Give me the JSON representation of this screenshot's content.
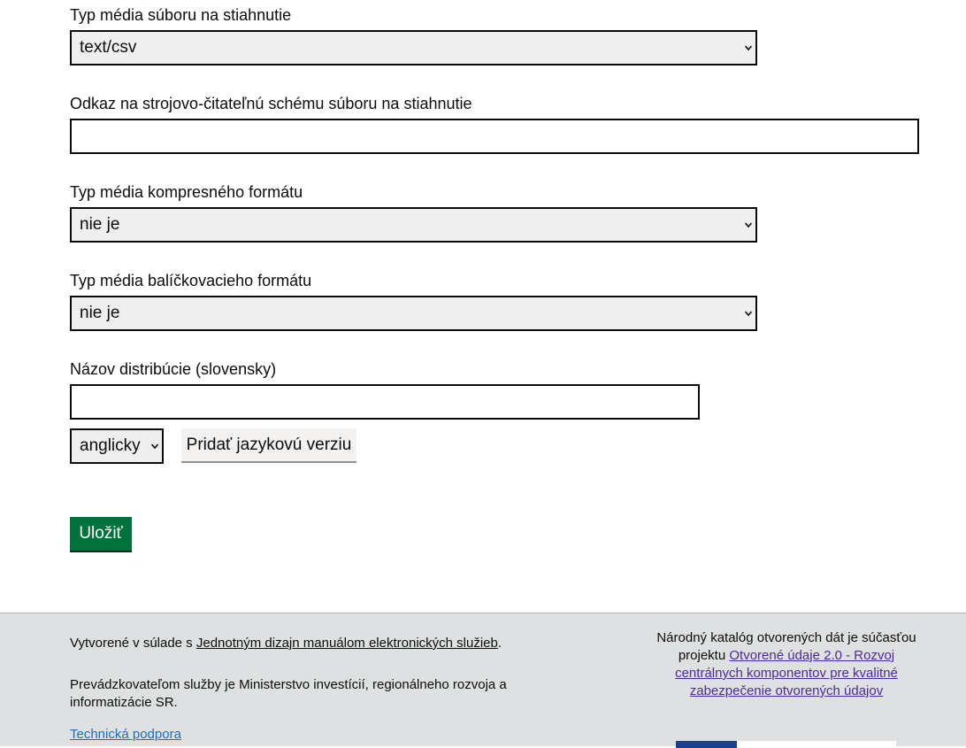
{
  "form": {
    "media_type_label": "Typ média súboru na stiahnutie",
    "media_type_value": "text/csv",
    "schema_label": "Odkaz na strojovo-čitateľnú schému súboru na stiahnutie",
    "schema_value": "",
    "compress_label": "Typ média kompresného formátu",
    "compress_value": "nie je",
    "package_label": "Typ média balíčkovacieho formátu",
    "package_value": "nie je",
    "name_label": "Názov distribúcie (slovensky)",
    "name_value": "",
    "language_value": "anglicky",
    "add_language_label": "Pridať jazykovú verziu",
    "save_label": "Uložiť"
  },
  "footer": {
    "created_prefix": "Vytvorené v súlade s ",
    "created_link": "Jednotným dizajn manuálom elektronických služieb",
    "created_suffix": ".",
    "operator": "Prevádzkovateľom služby je Ministerstvo investícií, regionálneho rozvoja a informatizácie SR.",
    "support_link": "Technická podpora",
    "project_prefix": "Národný katalóg otvorených dát je súčasťou projektu ",
    "project_link": "Otvorené údaje 2.0 - Rozvoj centrálnych komponentov pre kvalitné zabezpečenie otvorených údajov"
  },
  "colors": {
    "primary_button": "#00703c",
    "footer_bg": "#dee0e2",
    "support_link": "#1d70b8",
    "visited_link": "#4c2c92"
  },
  "icons": {
    "select_arrow": "chevron-down-icon"
  }
}
